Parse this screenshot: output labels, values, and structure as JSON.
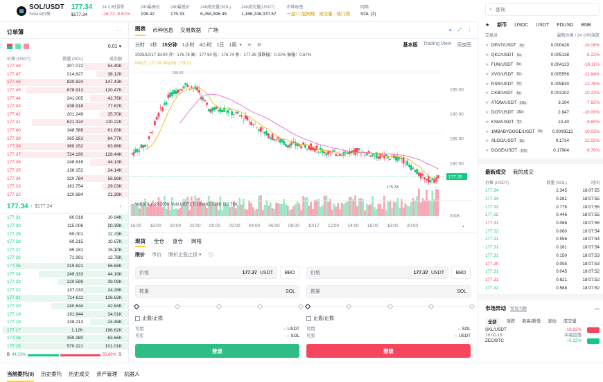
{
  "pair": {
    "symbol": "SOL/USDT",
    "subtitle": "Solana价格",
    "price": "177.34",
    "price_usd": "$177.34"
  },
  "stats": [
    {
      "k": "24 小时涨跌",
      "v": "-16.72 -8.61%",
      "c": "r"
    },
    {
      "k": "24h最高价",
      "v": "198.42",
      "c": ""
    },
    {
      "k": "24h最低价",
      "v": "175.33",
      "c": ""
    },
    {
      "k": "24h成交量(SOL)",
      "v": "6,264,998.45",
      "c": ""
    },
    {
      "k": "24h成交量(USDT)",
      "v": "1,166,248,070.57",
      "c": ""
    },
    {
      "k": "币种标签",
      "v": "一层/二层网络 · 成交量 · 热门榜",
      "c": "y"
    },
    {
      "k": "网络",
      "v": "SOL (2)",
      "c": ""
    }
  ],
  "orderbook": {
    "title": "订单薄",
    "precision": "0.01",
    "headers": [
      "价格 (USDT)",
      "数量 (SOL)",
      "成交额"
    ],
    "asks": [
      [
        "177.48",
        "307.072",
        "54.49K",
        0.35
      ],
      [
        "177.47",
        "214.827",
        "38.12K",
        0.25
      ],
      [
        "177.46",
        "830.824",
        "147.43K",
        0.95
      ],
      [
        "177.45",
        "678.913",
        "120.47K",
        0.8
      ],
      [
        "177.44",
        "241.005",
        "42.76K",
        0.3
      ],
      [
        "177.43",
        "438.918",
        "77.87K",
        0.5
      ],
      [
        "177.42",
        "201.249",
        "35.70K",
        0.22
      ],
      [
        "177.41",
        "621.324",
        "110.22K",
        0.75
      ],
      [
        "177.40",
        "348.569",
        "61.83K",
        0.4
      ],
      [
        "177.39",
        "365.161",
        "64.77K",
        0.42
      ],
      [
        "177.38",
        "360.152",
        "63.88K",
        0.9
      ],
      [
        "177.37",
        "724.190",
        "128.44K",
        0.85
      ],
      [
        "177.36",
        "248.816",
        "44.13K",
        0.3
      ],
      [
        "177.35",
        "136.152",
        "24.14K",
        0.18
      ],
      [
        "177.34",
        "320.784",
        "56.88K",
        0.4
      ],
      [
        "177.33",
        "163.754",
        "29.03K",
        0.2
      ],
      [
        "177.32",
        "120.684",
        "21.39K",
        0.15
      ]
    ],
    "mid": "177.34",
    "mid_usd": "$177.34",
    "bids": [
      [
        "177.31",
        "60.018",
        "10.64K",
        0.1
      ],
      [
        "177.30",
        "115.008",
        "20.39K",
        0.16
      ],
      [
        "177.29",
        "69.001",
        "12.23K",
        0.1
      ],
      [
        "177.28",
        "60.215",
        "10.67K",
        0.1
      ],
      [
        "177.27",
        "85.181",
        "15.10K",
        0.12
      ],
      [
        "177.26",
        "71.991",
        "12.76K",
        0.1
      ],
      [
        "177.25",
        "319.821",
        "56.68K",
        0.9
      ],
      [
        "177.24",
        "249.333",
        "44.19K",
        0.7
      ],
      [
        "177.23",
        "220.599",
        "39.09K",
        0.55
      ],
      [
        "177.22",
        "137.033",
        "24.28K",
        0.35
      ],
      [
        "177.21",
        "714.611",
        "126.63K",
        0.95
      ],
      [
        "177.20",
        "240.644",
        "42.64K",
        0.6
      ],
      [
        "177.19",
        "191.944",
        "34.01K",
        0.45
      ],
      [
        "177.18",
        "138.213",
        "24.48K",
        0.3
      ],
      [
        "177.17",
        "1.12K",
        "198.62K",
        0.98
      ],
      [
        "177.16",
        "359.380",
        "63.66K",
        0.9
      ],
      [
        "177.15",
        "570.221",
        "101.01K",
        0.92
      ]
    ],
    "buy_pct": "44.33%",
    "sell_pct": "55.69%",
    "buy_label": "B",
    "sell_label": "S"
  },
  "chart": {
    "tabs": [
      "图表",
      "币种信息",
      "交易数据",
      "广场"
    ],
    "intervals": [
      "分时",
      "1秒",
      "15分钟",
      "1小时",
      "4小时",
      "1日",
      "1周"
    ],
    "views": [
      "基本版",
      "Trading View",
      "深度图"
    ],
    "info": "2025/10/17 18:00  开：176.78  高：177.94  低：176.74  收：177.35  涨跌幅：0.31%  振幅：0.67%",
    "ma": "MA(7): 177.04  MA(25): 178.21",
    "high_label": "198.42",
    "low_label": "175.33",
    "y_labels": [
      "195.00",
      "190.00",
      "185.00",
      "180.00"
    ],
    "last_price": "177.35",
    "vol_info": "Vol(SOL): 29.205K  Vol(USDT): 5.18M  82.033K  112.76K",
    "vol_y": "200K",
    "x_labels": [
      "16:00",
      "18:00",
      "20:00",
      "22:00",
      "00:00",
      "02:00",
      "04:00",
      "06:00",
      "08:00",
      "10/17",
      "12:00",
      "14:00",
      "16:00",
      "18:00",
      "20:00"
    ]
  },
  "trade": {
    "tabs": [
      "现货",
      "全仓",
      "逐仓",
      "网格"
    ],
    "types": [
      "限价",
      "市价",
      "限价止盈止损"
    ],
    "price_label": "价格",
    "price_val": "177.37",
    "unit": "USDT",
    "bbo": "BBO",
    "qty_label": "数量",
    "qty_unit": "SOL",
    "tpsl": "止盈/止损",
    "avail_label": "可用",
    "avail_buy": "-- USDT",
    "avail_sell": "-- SOL",
    "can_buy": "可买",
    "can_buy_v": "-- SOL",
    "can_sell": "可卖",
    "can_sell_v": "-- USDT",
    "login": "登录"
  },
  "market": {
    "search": "查询",
    "tabs": [
      "新币",
      "USDC",
      "USDT",
      "FDUSD",
      "BNB"
    ],
    "headers": [
      "交易对",
      "最新价格 / 24 小时涨跌"
    ],
    "rows": [
      [
        "DENT/USDT",
        "5x",
        "0.000428",
        "-10.08%"
      ],
      [
        "QKC/USDT",
        "5x",
        "0.005138",
        "-8.22%"
      ],
      [
        "FUN/USDT",
        "5x",
        "0.004123",
        "-18.11%"
      ],
      [
        "XVG/USDT",
        "5x",
        "0.005556",
        "-11.84%"
      ],
      [
        "RSR/USDT",
        "5x",
        "0.005830",
        "-12.76%"
      ],
      [
        "CKB/USDT",
        "5x",
        "0.003102",
        "-10.22%"
      ],
      [
        "ATOM/USDT",
        "10x",
        "3.104",
        "-7.92%"
      ],
      [
        "DOT/USDT",
        "10x",
        "2.847",
        "-10.00%"
      ],
      [
        "KSM/USDT",
        "5x",
        "10.40",
        "-9.80%"
      ],
      [
        "1MBABYDOGE/USDT",
        "5x",
        "0.0009512",
        "-10.03%"
      ],
      [
        "ALGO/USDT",
        "5x",
        "0.1734",
        "-12.02%"
      ],
      [
        "DOGE/USDT",
        "10x",
        "0.17904",
        "-9.76%"
      ]
    ]
  },
  "trades": {
    "tabs": [
      "最新成交",
      "我的成交"
    ],
    "headers": [
      "价格 (USDT)",
      "数量 (SOL)",
      "时间"
    ],
    "rows": [
      [
        "177.34",
        "2.345",
        "18:07:55",
        "g"
      ],
      [
        "177.34",
        "0.281",
        "18:07:55",
        "g"
      ],
      [
        "177.33",
        "0.776",
        "18:07:55",
        "g"
      ],
      [
        "177.32",
        "0.446",
        "18:07:55",
        "g"
      ],
      [
        "177.31",
        "0.068",
        "18:07:55",
        "r"
      ],
      [
        "177.32",
        "0.060",
        "18:07:54",
        "g"
      ],
      [
        "177.31",
        "0.556",
        "18:07:54",
        "g"
      ],
      [
        "177.31",
        "0.281",
        "18:07:54",
        "g"
      ],
      [
        "177.31",
        "0.150",
        "18:07:53",
        "g"
      ],
      [
        "177.30",
        "0.055",
        "18:07:53",
        "r"
      ],
      [
        "177.31",
        "0.045",
        "18:07:52",
        "g"
      ],
      [
        "177.31",
        "0.621",
        "18:07:52",
        "r"
      ],
      [
        "177.32",
        "0.588",
        "18:07:52",
        "g"
      ]
    ]
  },
  "movers": {
    "title": "市场异动",
    "link": "常见问题",
    "tabs": [
      "全部",
      "涨跌",
      "新高/新低",
      "波动",
      "成交量"
    ],
    "rows": [
      [
        "SKL/USDT",
        "18:00:19",
        "-18.82%",
        "冲高回落",
        "r"
      ],
      [
        "ZEC/BTC",
        "",
        "+5.22%",
        "",
        "g"
      ]
    ]
  },
  "bottom_tabs": [
    "当前委托(0)",
    "历史委托",
    "历史成交",
    "资产管理",
    "机器人"
  ]
}
